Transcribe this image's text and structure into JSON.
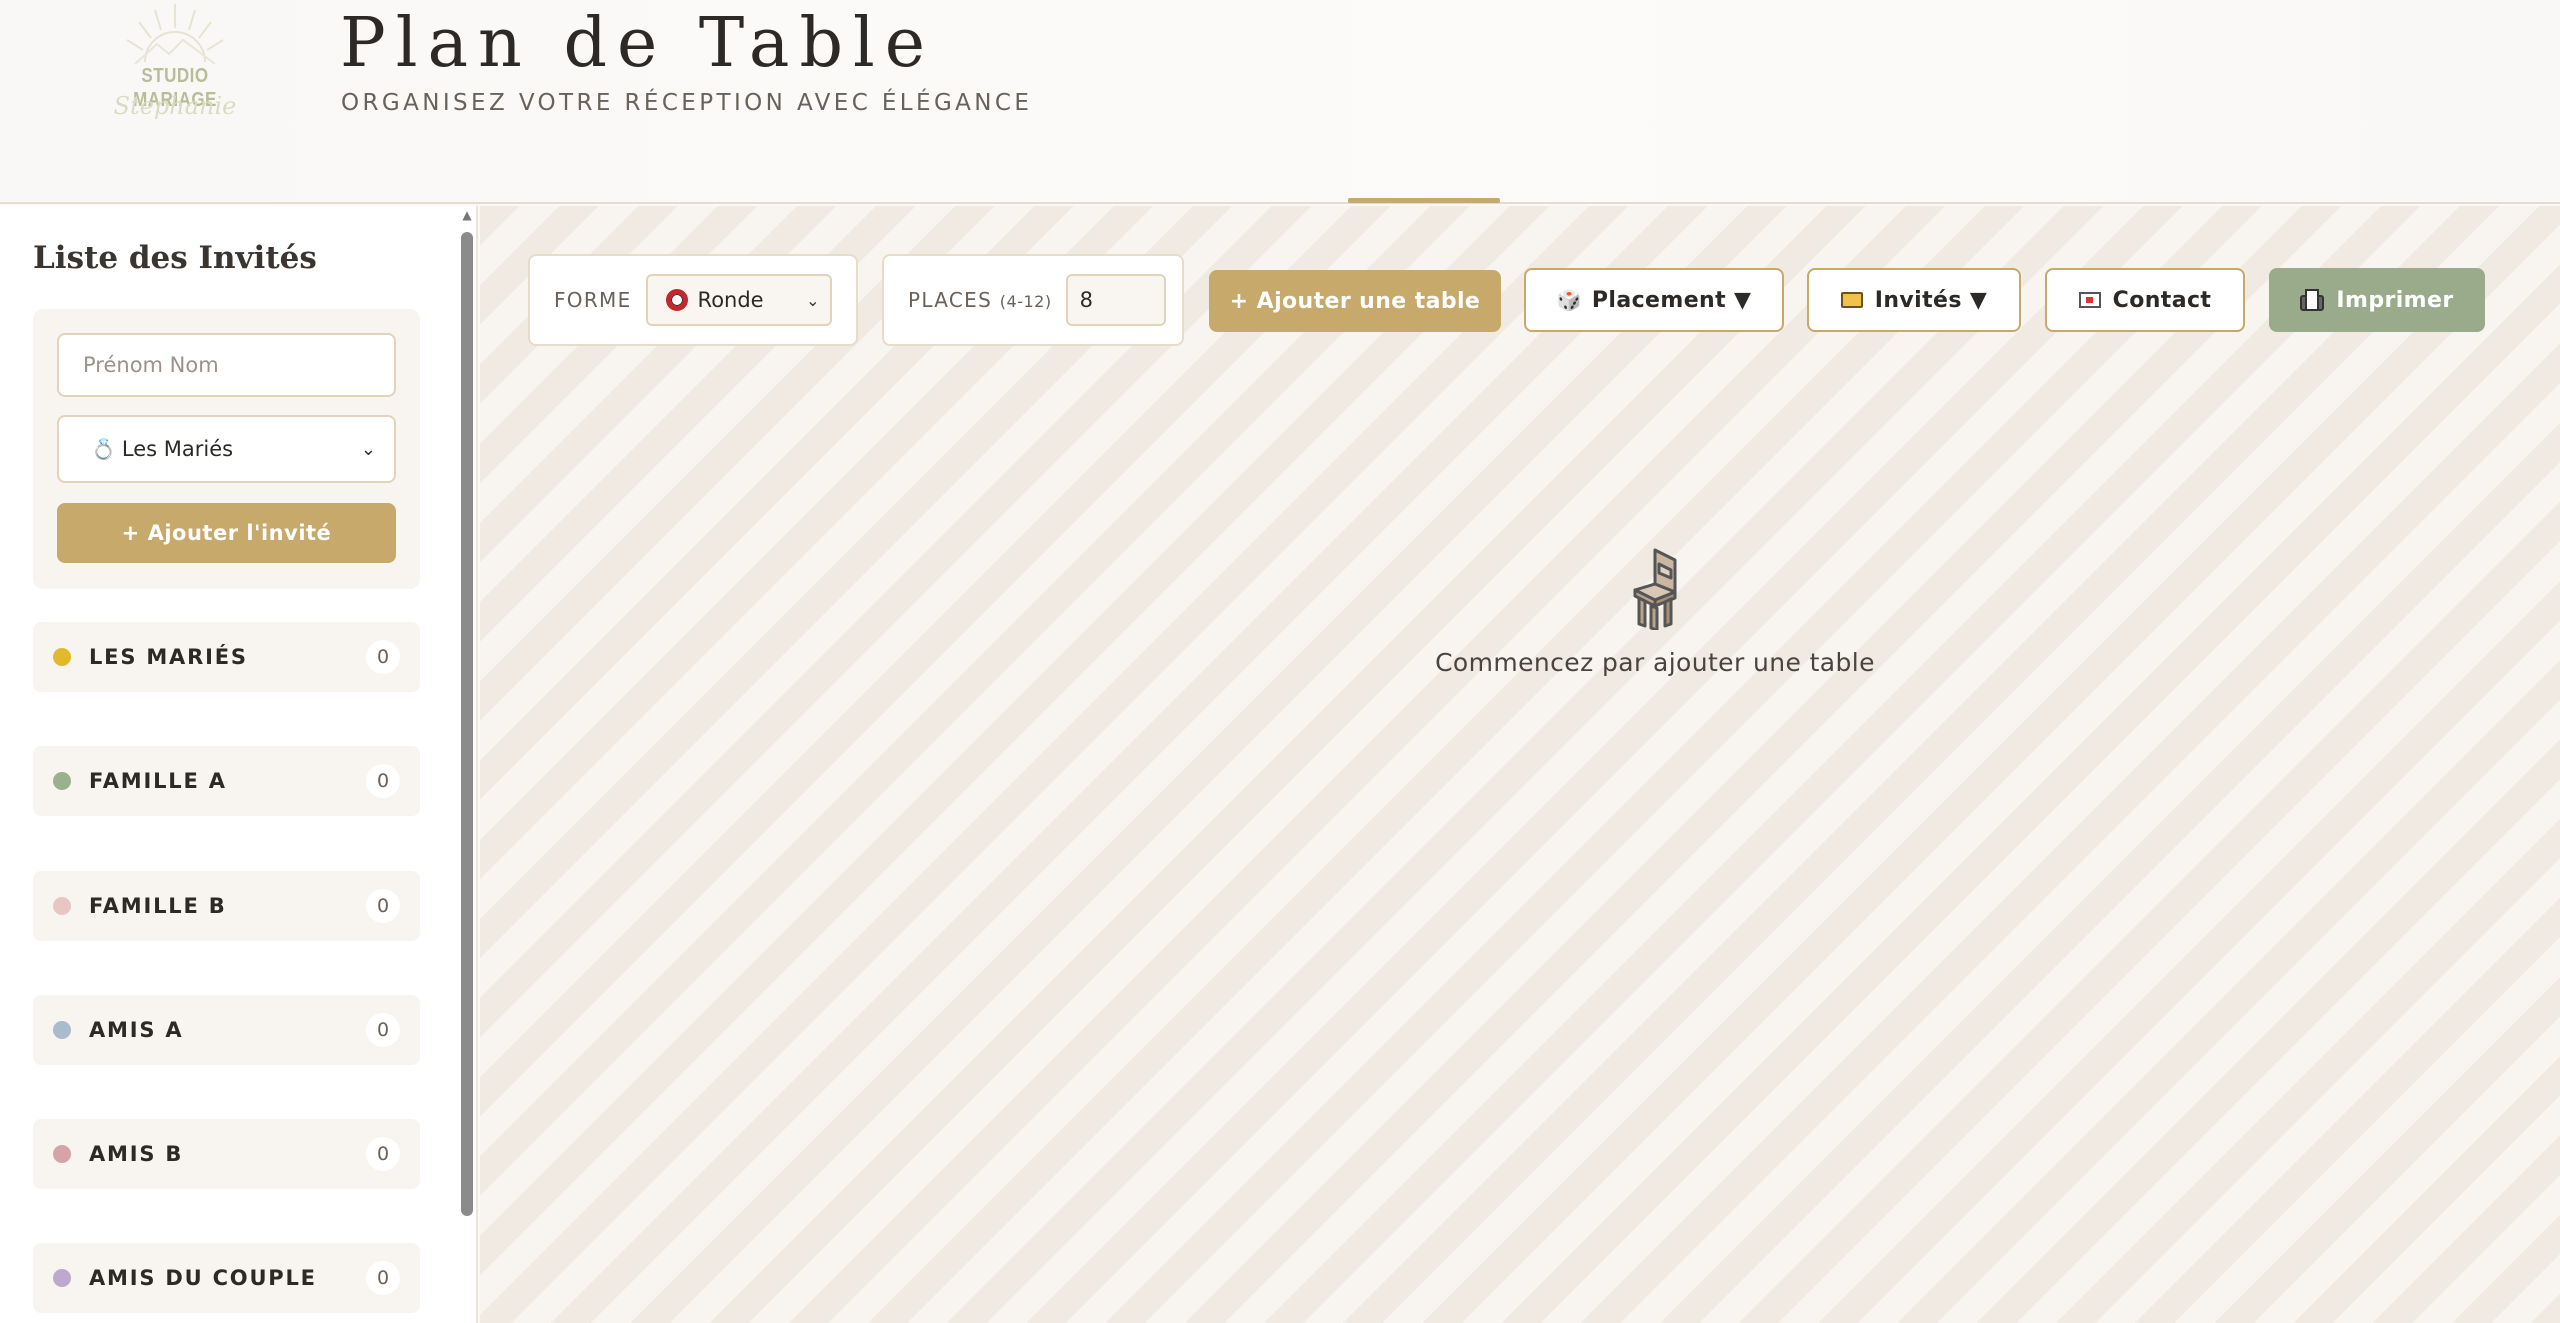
{
  "header": {
    "logo_text": "STUDIO MARIAGE",
    "logo_script": "Stephanie",
    "title": "Plan de Table",
    "subtitle": "ORGANISEZ VOTRE RÉCEPTION AVEC ÉLÉGANCE"
  },
  "sidebar": {
    "title": "Liste des Invités",
    "name_placeholder": "Prénom Nom",
    "group_select_value": "Les Mariés",
    "add_guest_label": "+ Ajouter l'invité",
    "groups": [
      {
        "label": "LES MARIÉS",
        "count": "0",
        "color": "#e2b92c"
      },
      {
        "label": "FAMILLE A",
        "count": "0",
        "color": "#9bb08c"
      },
      {
        "label": "FAMILLE B",
        "count": "0",
        "color": "#e8c6c3"
      },
      {
        "label": "AMIS A",
        "count": "0",
        "color": "#a9bccb"
      },
      {
        "label": "AMIS B",
        "count": "0",
        "color": "#d6a4a8"
      },
      {
        "label": "AMIS DU COUPLE",
        "count": "0",
        "color": "#bfa8cf"
      }
    ]
  },
  "toolbar": {
    "shape_label": "FORME",
    "shape_value": "Ronde",
    "places_label": "PLACES",
    "places_range": "(4-12)",
    "places_value": "8",
    "add_table_label": "+ Ajouter une table",
    "placement_label": "Placement ▼",
    "invites_label": "Invités ▼",
    "contact_label": "Contact",
    "print_label": "Imprimer"
  },
  "empty_state": {
    "message": "Commencez par ajouter une table"
  },
  "colors": {
    "accent_gold": "#c6a96b",
    "sage": "#9aab8c"
  }
}
